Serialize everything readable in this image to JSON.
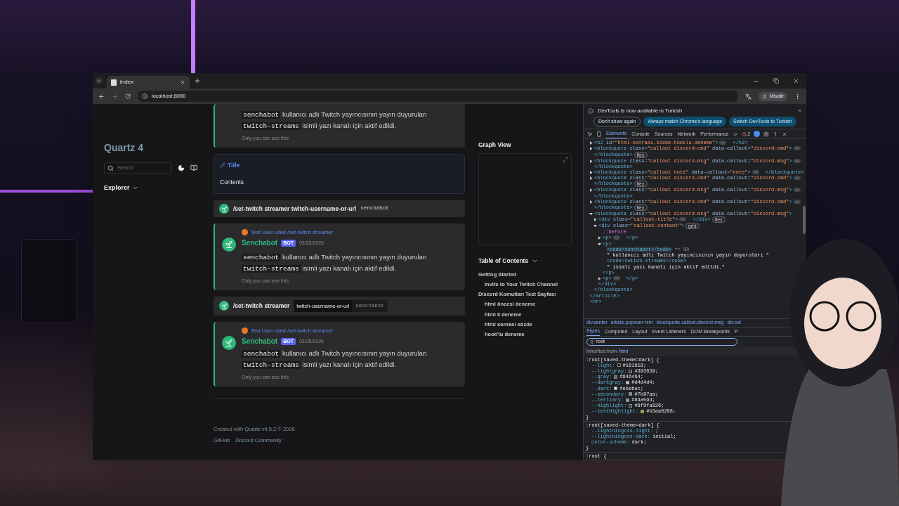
{
  "browser": {
    "tab_title": "index",
    "url": "localhost:8080",
    "profile": "Misafir"
  },
  "site": {
    "title": "Quartz 4",
    "search_placeholder": "Search",
    "explorer": "Explorer"
  },
  "blocks": [
    {
      "kind": "message",
      "inline_body": false,
      "body": [
        {
          "code": true,
          "text": "senchabot"
        },
        {
          "code": false,
          "text": " kullanıcı adlı Twitch yayıncısının yayın duyuruları "
        },
        {
          "code": true,
          "text": "twitch-streams"
        },
        {
          "code": false,
          "text": " isimli yazı kanalı için aktif edildi."
        }
      ],
      "note": "Only you can see this"
    },
    {
      "kind": "callout",
      "title": "Title",
      "content": "Contents"
    },
    {
      "kind": "command",
      "command": "/set-twitch streamer twitch-username-or-url",
      "value": "senchabot"
    },
    {
      "kind": "message",
      "reply": "Test User used /set-twitch streamer",
      "author": "Senchabot",
      "badge": "BOT",
      "time": "03/25/2026",
      "inline_body": true,
      "body": [
        {
          "code": true,
          "text": "senchabot"
        },
        {
          "code": false,
          "text": " kullanıcı adlı Twitch yayıncısının yayın duyuruları "
        },
        {
          "code": true,
          "text": "twitch-streams"
        },
        {
          "code": false,
          "text": " isimli yazı kanalı için aktif edildi."
        }
      ],
      "note": "Only you can see this"
    },
    {
      "kind": "command",
      "command": "/set-twitch streamer",
      "option": "twitch-username-or-url",
      "value": "senchabot"
    },
    {
      "kind": "message",
      "reply": "Test User used /set-twitch streamer",
      "author": "Senchabot",
      "badge": "BOT",
      "time": "03/25/2026",
      "inline_body": false,
      "body": [
        {
          "code": true,
          "text": "senchabot"
        },
        {
          "code": false,
          "text": " kullanıcı adlı Twitch yayıncısının yayın duyuruları "
        },
        {
          "code": true,
          "text": "twitch-streams"
        },
        {
          "code": false,
          "text": " isimli yazı kanalı için aktif edildi."
        }
      ],
      "note": "Only you can see this"
    }
  ],
  "graph_title": "Graph View",
  "toc": {
    "title": "Table of Contents",
    "items": [
      {
        "text": "Getting Started",
        "children": [
          {
            "text": "Invite to Your Twitch Channel"
          }
        ]
      },
      {
        "text": "Discord Komutları Test Sayfası",
        "children": [
          {
            "text": "html öncesi deneme"
          },
          {
            "text": "html li deneme"
          },
          {
            "text": "html sonrası sözde"
          },
          {
            "text": "hook'lu deneme"
          }
        ]
      }
    ]
  },
  "footer": {
    "created": "Created with",
    "link": "Quartz v4.5.2",
    "year": "© 2026",
    "links": [
      "GitHub",
      "Discord Community"
    ]
  },
  "devtools": {
    "notice": {
      "text": "DevTools is now available in Turkish",
      "buttons": [
        {
          "label": "Don't show again",
          "kind": "outline"
        },
        {
          "label": "Always match Chrome's language",
          "kind": "filled"
        },
        {
          "label": "Switch DevTools to Turkish",
          "kind": "filled"
        }
      ]
    },
    "tabs": [
      {
        "label": "Elements",
        "selected": true
      },
      {
        "label": "Console",
        "selected": false
      },
      {
        "label": "Sources",
        "selected": false
      },
      {
        "label": "Network",
        "selected": false
      },
      {
        "label": "Performance",
        "selected": false
      }
    ],
    "warnings": "2",
    "dom": [
      {
        "kind": "element",
        "close": "</article>",
        "children": [
          {
            "kind": "element",
            "open": "<h2 id=\"html-sonrası-sözde-hooklu-deneme\">",
            "close": "</h2>",
            "expanded": false
          },
          {
            "kind": "element",
            "open": "<blockquote class=\"callout discord-cmd\" data-callout=\"discord-cmd\">",
            "close": "</blockquote>",
            "badge": "flex",
            "expanded": false
          },
          {
            "kind": "element",
            "open": "<blockquote class=\"callout discord-msg\" data-callout=\"discord-msg\">",
            "close": "</blockquote>",
            "expanded": false
          },
          {
            "kind": "element",
            "open": "<blockquote class=\"callout note\" data-callout=\"note\">",
            "close": "</blockquote>",
            "expanded": false
          },
          {
            "kind": "element",
            "open": "<blockquote class=\"callout discord-cmd\" data-callout=\"discord-cmd\">",
            "close": "</blockquote>",
            "badge": "flex",
            "expanded": false
          },
          {
            "kind": "element",
            "open": "<blockquote class=\"callout discord-msg\" data-callout=\"discord-msg\">",
            "close": "</blockquote>",
            "expanded": false
          },
          {
            "kind": "element",
            "open": "<blockquote class=\"callout discord-cmd\" data-callout=\"discord-cmd\">",
            "close": "</blockquote>",
            "badge": "flex",
            "expanded": false
          },
          {
            "kind": "element",
            "open": "<blockquote class=\"callout discord-msg\" data-callout=\"discord-msg\">",
            "close": "</blockquote>",
            "expanded": true,
            "children": [
              {
                "kind": "element",
                "open": "<div class=\"callout-title\">",
                "close": "</div>",
                "badge": "flex",
                "expanded": false
              },
              {
                "kind": "element",
                "open": "<div class=\"callout-content\">",
                "close": "</div>",
                "badge": "grid",
                "expanded": true,
                "children": [
                  {
                    "kind": "pseudo",
                    "text": "::before"
                  },
                  {
                    "kind": "element",
                    "open": "<p>",
                    "close": "</p>",
                    "expanded": false
                  },
                  {
                    "kind": "element",
                    "open": "<p>",
                    "close": "</p>",
                    "expanded": true,
                    "children": [
                      {
                        "kind": "code",
                        "text": "<code>senchabot</code>",
                        "marker": "== $0",
                        "selected": true
                      },
                      {
                        "kind": "text",
                        "text": "\" kullanıcı adlı Twitch yayıncısının yayın duyuruları \""
                      },
                      {
                        "kind": "code",
                        "text": "<code>twitch-streams</code>",
                        "selected": false
                      },
                      {
                        "kind": "text",
                        "text": "\" isimli yazı kanalı için aktif edildi.\""
                      }
                    ]
                  },
                  {
                    "kind": "element",
                    "open": "<p>",
                    "close": "</p>",
                    "expanded": false
                  }
                ]
              }
            ]
          }
        ]
      },
      {
        "kind": "void",
        "open": "<hr>"
      }
    ],
    "breadcrumbs": [
      "div.center",
      "article.popover-hint",
      "blockquote.callout.discord-msg",
      "div.cal"
    ],
    "style_tabs": [
      {
        "label": "Styles",
        "selected": true
      },
      {
        "label": "Computed",
        "selected": false
      },
      {
        "label": "Layout",
        "selected": false
      },
      {
        "label": "Event Listeners",
        "selected": false
      },
      {
        "label": "DOM Breakpoints",
        "selected": false
      },
      {
        "label": "P",
        "selected": false
      }
    ],
    "filter": "root",
    "inherited": {
      "label": "Inherited from",
      "source": "html"
    },
    "rules": [
      {
        "selector": ":root[saved-theme=dark] {",
        "props": [
          {
            "name": "--light:",
            "value": "#161618;",
            "color": "#161618"
          },
          {
            "name": "--lightgray:",
            "value": "#393639;",
            "color": "#393639"
          },
          {
            "name": "--gray:",
            "value": "#646464;",
            "color": "#646464"
          },
          {
            "name": "--darkgray:",
            "value": "#d4d4d4;",
            "color": "#d4d4d4"
          },
          {
            "name": "--dark:",
            "value": "#ebebec;",
            "color": "#ebebec"
          },
          {
            "name": "--secondary:",
            "value": "#7b97aa;",
            "color": "#7b97aa"
          },
          {
            "name": "--tertiary:",
            "value": "#84a59d;",
            "color": "#84a59d"
          },
          {
            "name": "--highlight:",
            "value": "#8f9fa926;",
            "color": "#3a3d40"
          },
          {
            "name": "--textHighlight:",
            "value": "#b3aa0288;",
            "color": "#b3aa02"
          }
        ],
        "close": "}"
      },
      {
        "selector": ":root[saved-theme=dark] {",
        "props": [
          {
            "name": "--lightningcss-light:",
            "value": ";"
          },
          {
            "name": "--lightningcss-dark:",
            "value": "initial;"
          },
          {
            "name": "color-scheme:",
            "value": "dark;"
          }
        ],
        "close": "}"
      },
      {
        "selector": ":root {"
      }
    ]
  }
}
